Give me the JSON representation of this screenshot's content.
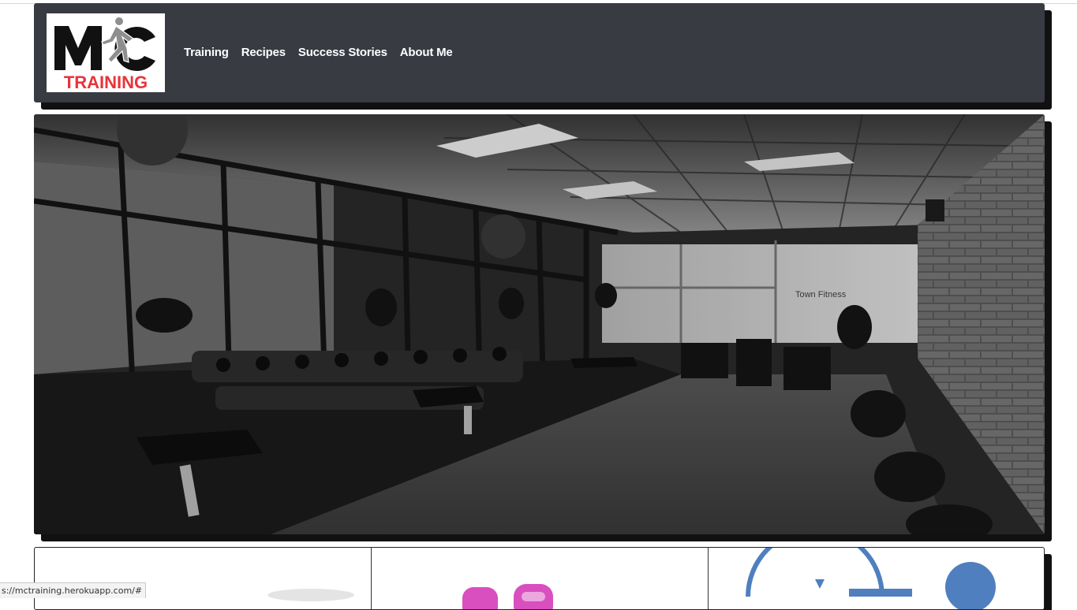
{
  "logo": {
    "letters": "MC",
    "word": "TRAINING",
    "colors": {
      "dark": "#111111",
      "accent": "#e8333a"
    }
  },
  "nav": {
    "items": [
      {
        "label": "Training"
      },
      {
        "label": "Recipes"
      },
      {
        "label": "Success Stories"
      },
      {
        "label": "About Me"
      }
    ]
  },
  "hero": {
    "window_sign": "Town Fitness"
  },
  "colors": {
    "navbar_bg": "#393b43",
    "shadow": "#111111",
    "card_pink": "#d94fbf",
    "card_blue": "#4f7fbf"
  },
  "status": {
    "url": "s://mctraining.herokuapp.com/#"
  }
}
